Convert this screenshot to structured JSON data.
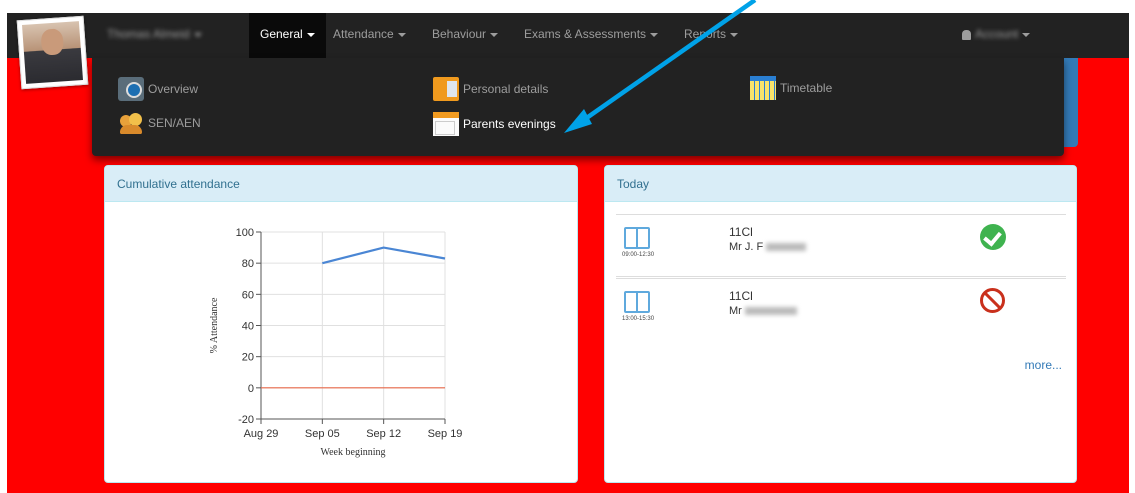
{
  "navbar": {
    "user_name": "Thomas Almeid",
    "menus": [
      "General",
      "Attendance",
      "Behaviour",
      "Exams & Assessments",
      "Reports"
    ],
    "account_label": "Account"
  },
  "general_menu": {
    "items": [
      "Overview",
      "Personal details",
      "Timetable",
      "SEN/AEN",
      "Parents evenings"
    ],
    "highlighted": "Parents evenings"
  },
  "attendance_panel": {
    "title": "Cumulative attendance"
  },
  "chart_data": {
    "type": "line",
    "x": [
      "Aug 29",
      "Sep 05",
      "Sep 12",
      "Sep 19"
    ],
    "series": [
      {
        "values": [
          null,
          80,
          90,
          83
        ],
        "color": "#4a86d4"
      }
    ],
    "reference_line": {
      "y": 0,
      "color": "#e8684a"
    },
    "ylabel": "% Attendance",
    "xlabel": "Week beginning",
    "ylim": [
      -20,
      100
    ],
    "yticks": [
      100,
      80,
      60,
      40,
      20,
      0,
      -20
    ],
    "grid": true
  },
  "today_panel": {
    "title": "Today",
    "rows": [
      {
        "time": "09:00-12:30",
        "class": "11Cl",
        "teacher": "Mr J. F",
        "status": "present"
      },
      {
        "time": "13:00-15:30",
        "class": "11Cl",
        "teacher": "Mr",
        "status": "absent"
      }
    ],
    "more_label": "more..."
  },
  "colors": {
    "page_background": "#ff0000",
    "navbar": "#222222",
    "panel_heading": "#d9edf7",
    "annotation_arrow": "#00a2e8"
  }
}
